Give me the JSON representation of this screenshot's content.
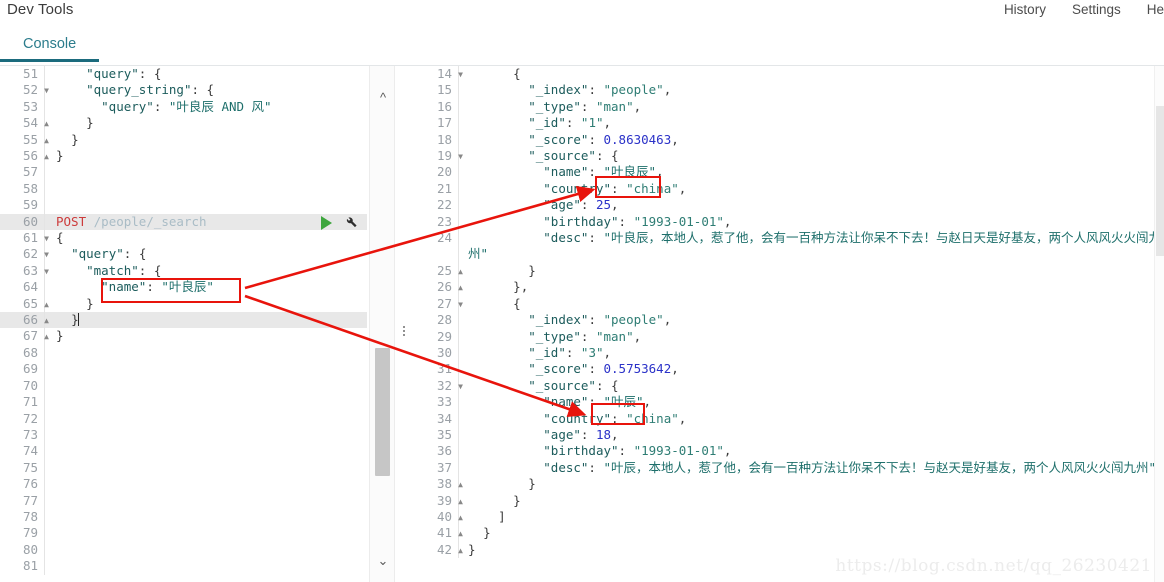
{
  "header": {
    "app_title": "Dev Tools",
    "nav": [
      {
        "label": "History"
      },
      {
        "label": "Settings"
      },
      {
        "label": "He"
      }
    ],
    "tabs": [
      {
        "label": "Console",
        "active": true
      }
    ]
  },
  "left_pane": {
    "name": "request-editor",
    "lines": [
      {
        "num": "51",
        "fold": "",
        "partial": true,
        "text": "    \"query\": {"
      },
      {
        "num": "52",
        "fold": "down",
        "text": "    \"query_string\": {"
      },
      {
        "num": "53",
        "fold": "",
        "text": "      \"query\": \"叶良辰 AND 风\""
      },
      {
        "num": "54",
        "fold": "up",
        "text": "    }"
      },
      {
        "num": "55",
        "fold": "up",
        "text": "  }"
      },
      {
        "num": "56",
        "fold": "up",
        "text": "}"
      },
      {
        "num": "57",
        "fold": "",
        "text": ""
      },
      {
        "num": "58",
        "fold": "",
        "text": ""
      },
      {
        "num": "59",
        "fold": "",
        "text": ""
      },
      {
        "num": "60",
        "fold": "",
        "text": "POST /people/_search",
        "is_request": true
      },
      {
        "num": "61",
        "fold": "down",
        "text": "{"
      },
      {
        "num": "62",
        "fold": "down",
        "text": "  \"query\": {"
      },
      {
        "num": "63",
        "fold": "down",
        "text": "    \"match\": {"
      },
      {
        "num": "64",
        "fold": "",
        "text": "      \"name\": \"叶良辰\""
      },
      {
        "num": "65",
        "fold": "up",
        "text": "    }"
      },
      {
        "num": "66",
        "fold": "up",
        "text": "  }",
        "highlight": true,
        "cursor": true
      },
      {
        "num": "67",
        "fold": "up",
        "text": "}"
      },
      {
        "num": "68",
        "fold": "",
        "text": ""
      },
      {
        "num": "69",
        "fold": "",
        "text": ""
      },
      {
        "num": "70",
        "fold": "",
        "text": ""
      },
      {
        "num": "71",
        "fold": "",
        "text": ""
      },
      {
        "num": "72",
        "fold": "",
        "text": ""
      },
      {
        "num": "73",
        "fold": "",
        "text": ""
      },
      {
        "num": "74",
        "fold": "",
        "text": ""
      },
      {
        "num": "75",
        "fold": "",
        "text": ""
      },
      {
        "num": "76",
        "fold": "",
        "text": ""
      },
      {
        "num": "77",
        "fold": "",
        "text": ""
      },
      {
        "num": "78",
        "fold": "",
        "text": ""
      },
      {
        "num": "79",
        "fold": "",
        "text": ""
      },
      {
        "num": "80",
        "fold": "",
        "text": ""
      },
      {
        "num": "81",
        "fold": "",
        "text": ""
      }
    ],
    "request": {
      "method": "POST",
      "path": "/people/_search",
      "run_icon": "play-icon",
      "wrench_icon": "wrench-icon"
    }
  },
  "right_pane": {
    "name": "response-viewer",
    "lines": [
      {
        "num": "14",
        "fold": "down",
        "text": "      {"
      },
      {
        "num": "15",
        "fold": "",
        "text": "        \"_index\": \"people\","
      },
      {
        "num": "16",
        "fold": "",
        "text": "        \"_type\": \"man\","
      },
      {
        "num": "17",
        "fold": "",
        "text": "        \"_id\": \"1\","
      },
      {
        "num": "18",
        "fold": "",
        "text": "        \"_score\": 0.8630463,"
      },
      {
        "num": "19",
        "fold": "down",
        "text": "        \"_source\": {"
      },
      {
        "num": "20",
        "fold": "",
        "text": "          \"name\": \"叶良辰\","
      },
      {
        "num": "21",
        "fold": "",
        "text": "          \"country\": \"china\","
      },
      {
        "num": "22",
        "fold": "",
        "text": "          \"age\": 25,"
      },
      {
        "num": "23",
        "fold": "",
        "text": "          \"birthday\": \"1993-01-01\","
      },
      {
        "num": "24",
        "fold": "",
        "text": "          \"desc\": \"叶良辰，本地人，惹了他，会有一百种方法让你呆不下去！与赵日天是好基友，两个人风风火火闯九州\""
      },
      {
        "num": "25",
        "fold": "up",
        "text": "        }"
      },
      {
        "num": "26",
        "fold": "up",
        "text": "      },"
      },
      {
        "num": "27",
        "fold": "down",
        "text": "      {"
      },
      {
        "num": "28",
        "fold": "",
        "text": "        \"_index\": \"people\","
      },
      {
        "num": "29",
        "fold": "",
        "text": "        \"_type\": \"man\","
      },
      {
        "num": "30",
        "fold": "",
        "text": "        \"_id\": \"3\","
      },
      {
        "num": "31",
        "fold": "",
        "text": "        \"_score\": 0.5753642,"
      },
      {
        "num": "32",
        "fold": "down",
        "text": "        \"_source\": {"
      },
      {
        "num": "33",
        "fold": "",
        "text": "          \"name\": \"叶辰\","
      },
      {
        "num": "34",
        "fold": "",
        "text": "          \"country\": \"china\","
      },
      {
        "num": "35",
        "fold": "",
        "text": "          \"age\": 18,"
      },
      {
        "num": "36",
        "fold": "",
        "text": "          \"birthday\": \"1993-01-01\","
      },
      {
        "num": "37",
        "fold": "",
        "text": "          \"desc\": \"叶辰，本地人，惹了他，会有一百种方法让你呆不下去！与赵天是好基友，两个人风风火火闯九州\""
      },
      {
        "num": "38",
        "fold": "up",
        "text": "        }"
      },
      {
        "num": "39",
        "fold": "up",
        "text": "      }"
      },
      {
        "num": "40",
        "fold": "up",
        "text": "    ]"
      },
      {
        "num": "41",
        "fold": "up",
        "text": "  }"
      },
      {
        "num": "42",
        "fold": "up",
        "text": "}"
      }
    ]
  },
  "annotations": {
    "accent_color": "#e8140c",
    "boxes": [
      {
        "name": "query-name-highlight-box",
        "target": "left line 64 \"name\": \"叶良辰\""
      },
      {
        "name": "result-name-1-box",
        "target": "right line 20 \"叶良辰\""
      },
      {
        "name": "result-name-2-box",
        "target": "right line 33 \"叶辰\""
      }
    ],
    "arrows": [
      {
        "name": "arrow-to-result-1",
        "from": "query-name-highlight-box",
        "to": "result-name-1-box"
      },
      {
        "name": "arrow-to-result-2",
        "from": "query-name-highlight-box",
        "to": "result-name-2-box"
      }
    ]
  },
  "watermark": {
    "text": "https://blog.csdn.net/qq_26230421"
  },
  "scrollbars": {
    "left_up_icon": "chevron-up-icon",
    "left_down_icon": "chevron-down-icon",
    "drag_handle_icon": "vertical-dots-icon"
  }
}
